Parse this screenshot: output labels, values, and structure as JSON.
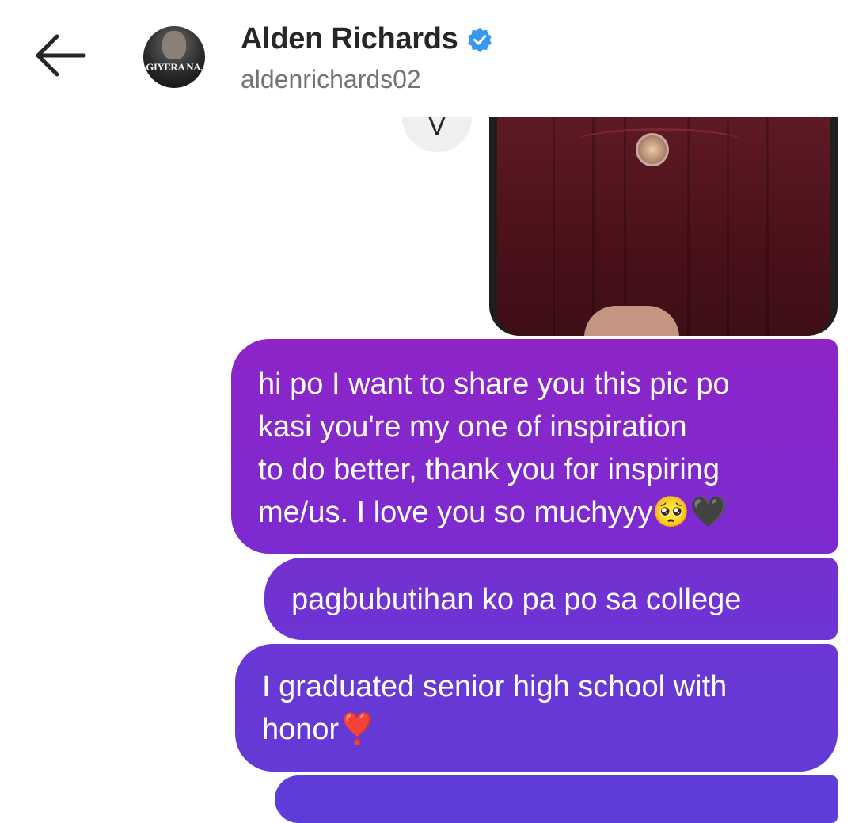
{
  "header": {
    "name": "Alden Richards",
    "handle": "aldenrichards02",
    "avatar_caption": "GIYERA NA.",
    "verified_color": "#3897f0"
  },
  "icons": {
    "back": "arrow-left-icon",
    "verified": "verified-badge-icon"
  },
  "reaction": {
    "glyph": "V"
  },
  "messages": [
    {
      "lines": [
        "hi po I want to share you this pic po",
        "kasi you're my one of inspiration",
        "to do better, thank you for inspiring",
        "me/us. I love you so muchyyy🥺🖤"
      ]
    },
    {
      "lines": [
        "pagbubutihan ko pa po sa college"
      ]
    },
    {
      "lines": [
        "I graduated senior high school with",
        "honor❣️"
      ]
    }
  ],
  "colors": {
    "bubble_top": "#8d25c8",
    "bubble_bottom": "#5e3cd7",
    "name_text": "#262626",
    "handle_text": "#737373"
  }
}
